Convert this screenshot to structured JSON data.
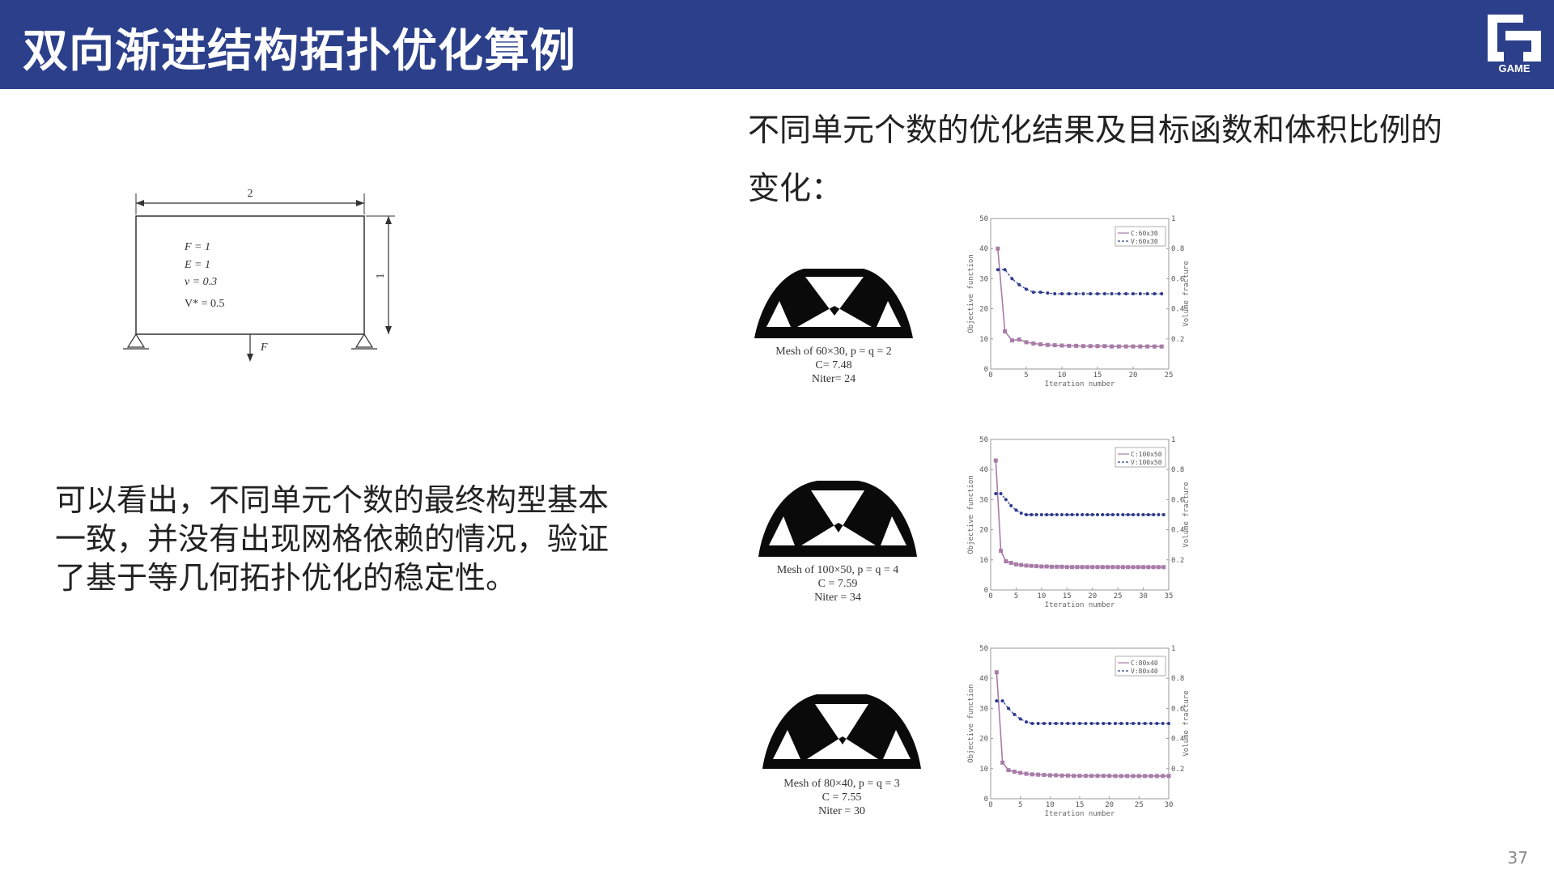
{
  "header": {
    "title": "双向渐进结构拓扑优化算例",
    "logo_text": "GAME"
  },
  "right_title": "不同单元个数的优化结果及目标函数和体积比例的变化：",
  "left_paragraph": "可以看出，不同单元个数的最终构型基本一致，并没有出现网格依赖的情况，验证了基于等几何拓扑优化的稳定性。",
  "page_number": "37",
  "problem": {
    "width_label": "2",
    "height_label": "1",
    "force_label": "F",
    "params": [
      "F = 1",
      "E = 1",
      "v = 0.3",
      "V* = 0.5"
    ]
  },
  "results": [
    {
      "caption": [
        "Mesh of 60×30,  p = q = 2",
        "C= 7.48",
        "Niter= 24"
      ],
      "chart_data": {
        "type": "line",
        "x": [
          1,
          2,
          3,
          4,
          5,
          6,
          7,
          8,
          9,
          10,
          11,
          12,
          13,
          14,
          15,
          16,
          17,
          18,
          19,
          20,
          21,
          22,
          23,
          24
        ],
        "series": [
          {
            "name": "C:60x30",
            "axis": "left",
            "values": [
              40,
              12.5,
              9.5,
              9.8,
              8.9,
              8.5,
              8.2,
              8.0,
              7.9,
              7.8,
              7.7,
              7.7,
              7.6,
              7.6,
              7.6,
              7.6,
              7.5,
              7.5,
              7.5,
              7.5,
              7.5,
              7.5,
              7.48,
              7.48
            ]
          },
          {
            "name": "V:60x30",
            "axis": "right",
            "values": [
              0.66,
              0.66,
              0.6,
              0.56,
              0.53,
              0.51,
              0.51,
              0.505,
              0.5,
              0.5,
              0.5,
              0.5,
              0.5,
              0.5,
              0.5,
              0.5,
              0.5,
              0.5,
              0.5,
              0.5,
              0.5,
              0.5,
              0.5,
              0.5
            ]
          }
        ],
        "xlim": [
          0,
          25
        ],
        "xticks": [
          0,
          5,
          10,
          15,
          20,
          25
        ],
        "ylim": [
          0,
          50
        ],
        "yticks": [
          0,
          10,
          20,
          30,
          40,
          50
        ],
        "y2lim": [
          0,
          1
        ],
        "y2ticks": [
          "0.2",
          "0.4",
          "0.6",
          "0.8",
          "1"
        ],
        "xlabel": "Iteration number",
        "ylabel": "Objective function",
        "y2label": "Volume fracture",
        "legend": "top-right"
      }
    },
    {
      "caption": [
        "Mesh of 100×50,  p = q = 4",
        "C = 7.59",
        "Niter = 34"
      ],
      "chart_data": {
        "type": "line",
        "x": [
          1,
          2,
          3,
          4,
          5,
          6,
          7,
          8,
          9,
          10,
          11,
          12,
          13,
          14,
          15,
          16,
          17,
          18,
          19,
          20,
          21,
          22,
          23,
          24,
          25,
          26,
          27,
          28,
          29,
          30,
          31,
          32,
          33,
          34
        ],
        "series": [
          {
            "name": "C:100x50",
            "axis": "left",
            "values": [
              43,
              13,
              9.5,
              9,
              8.5,
              8.3,
              8.1,
              8.0,
              7.9,
              7.8,
              7.8,
              7.7,
              7.7,
              7.7,
              7.6,
              7.6,
              7.6,
              7.6,
              7.6,
              7.6,
              7.6,
              7.6,
              7.6,
              7.6,
              7.6,
              7.59,
              7.59,
              7.59,
              7.59,
              7.59,
              7.59,
              7.59,
              7.59,
              7.59
            ]
          },
          {
            "name": "V:100x50",
            "axis": "right",
            "values": [
              0.64,
              0.64,
              0.6,
              0.56,
              0.53,
              0.51,
              0.5,
              0.5,
              0.5,
              0.5,
              0.5,
              0.5,
              0.5,
              0.5,
              0.5,
              0.5,
              0.5,
              0.5,
              0.5,
              0.5,
              0.5,
              0.5,
              0.5,
              0.5,
              0.5,
              0.5,
              0.5,
              0.5,
              0.5,
              0.5,
              0.5,
              0.5,
              0.5,
              0.5
            ]
          }
        ],
        "xlim": [
          0,
          35
        ],
        "xticks": [
          0,
          5,
          10,
          15,
          20,
          25,
          30,
          35
        ],
        "ylim": [
          0,
          50
        ],
        "yticks": [
          0,
          10,
          20,
          30,
          40,
          50
        ],
        "y2lim": [
          0,
          1
        ],
        "y2ticks": [
          "0.2",
          "0.4",
          "0.6",
          "0.8",
          "1"
        ],
        "xlabel": "Iteration number",
        "ylabel": "Objective function",
        "y2label": "Volume fracture",
        "legend": "top-right"
      }
    },
    {
      "caption": [
        "Mesh of 80×40,  p = q = 3",
        "C = 7.55",
        "Niter = 30"
      ],
      "chart_data": {
        "type": "line",
        "x": [
          1,
          2,
          3,
          4,
          5,
          6,
          7,
          8,
          9,
          10,
          11,
          12,
          13,
          14,
          15,
          16,
          17,
          18,
          19,
          20,
          21,
          22,
          23,
          24,
          25,
          26,
          27,
          28,
          29,
          30
        ],
        "series": [
          {
            "name": "C:80x40",
            "axis": "left",
            "values": [
              42,
              12,
              9.5,
              9,
              8.6,
              8.3,
              8.1,
              8.0,
              7.9,
              7.8,
              7.8,
              7.7,
              7.7,
              7.6,
              7.6,
              7.6,
              7.6,
              7.6,
              7.6,
              7.6,
              7.55,
              7.55,
              7.55,
              7.55,
              7.55,
              7.55,
              7.55,
              7.55,
              7.55,
              7.55
            ]
          },
          {
            "name": "V:80x40",
            "axis": "right",
            "values": [
              0.65,
              0.65,
              0.6,
              0.56,
              0.53,
              0.51,
              0.5,
              0.5,
              0.5,
              0.5,
              0.5,
              0.5,
              0.5,
              0.5,
              0.5,
              0.5,
              0.5,
              0.5,
              0.5,
              0.5,
              0.5,
              0.5,
              0.5,
              0.5,
              0.5,
              0.5,
              0.5,
              0.5,
              0.5,
              0.5
            ]
          }
        ],
        "xlim": [
          0,
          30
        ],
        "xticks": [
          0,
          5,
          10,
          15,
          20,
          25,
          30
        ],
        "ylim": [
          0,
          50
        ],
        "yticks": [
          0,
          10,
          20,
          30,
          40,
          50
        ],
        "y2lim": [
          0,
          1
        ],
        "y2ticks": [
          "0.2",
          "0.4",
          "0.6",
          "0.8",
          "1"
        ],
        "xlabel": "Iteration number",
        "ylabel": "Objective function",
        "y2label": "Volume fracture",
        "legend": "top-right"
      }
    }
  ],
  "colors": {
    "header_bg": "#2b3f8a",
    "series_C": "#a87ca8",
    "series_V": "#2e3a8c"
  }
}
